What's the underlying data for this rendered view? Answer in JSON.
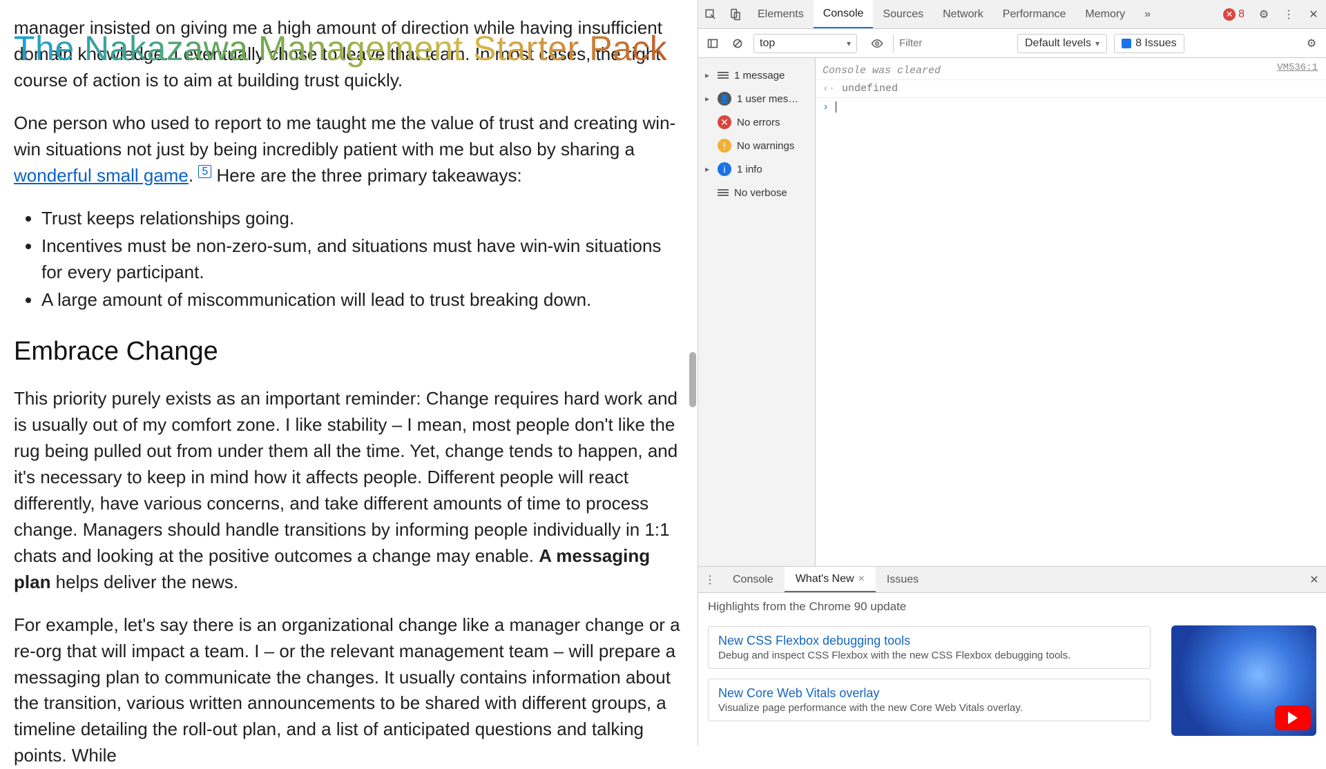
{
  "page": {
    "site_title": "The Nakazawa Management Starter Pack",
    "para1_pre": "manager insisted on giving me a high amount of direction while having insufficient domain knowledge. I eventually chose to leave that team. In most cases, the right course of action is to aim at building trust quickly.",
    "para2_a": "One person who used to report to me taught me the value of trust and creating win-win situations not just by being incredibly patient with me but also by sharing a ",
    "para2_link": "wonderful small game",
    "para2_b": ".",
    "para2_sup": "5",
    "para2_c": " Here are the three primary takeaways:",
    "bullets": [
      "Trust keeps relationships going.",
      "Incentives must be non-zero-sum, and situations must have win-win situations for every participant.",
      "A large amount of miscommunication will lead to trust breaking down."
    ],
    "h2": "Embrace Change",
    "para3_a": "This priority purely exists as an important reminder: Change requires hard work and is usually out of my comfort zone. I like stability – I mean, most people don't like the rug being pulled out from under them all the time. Yet, change tends to happen, and it's necessary to keep in mind how it affects people. Different people will react differently, have various concerns, and take different amounts of time to process change. Managers should handle transitions by informing people individually in 1:1 chats and looking at the positive outcomes a change may enable. ",
    "para3_bold": "A messaging plan",
    "para3_b": " helps deliver the news.",
    "para4": "For example, let's say there is an organizational change like a manager change or a re-org that will impact a team. I – or the relevant management team – will prepare a messaging plan to communicate the changes. It usually contains information about the transition, various written announcements to be shared with different groups, a timeline detailing the roll-out plan, and a list of anticipated questions and talking points. While"
  },
  "devtools": {
    "tabs": [
      "Elements",
      "Console",
      "Sources",
      "Network",
      "Performance",
      "Memory"
    ],
    "active_tab": "Console",
    "more_glyph": "»",
    "error_count": "8",
    "toolbar": {
      "context": "top",
      "filter_placeholder": "Filter",
      "levels_label": "Default levels",
      "issues_label": "8 Issues"
    },
    "sidebar": {
      "messages": "1 message",
      "user_msgs": "1 user mes…",
      "errors": "No errors",
      "warnings": "No warnings",
      "info": "1 info",
      "verbose": "No verbose"
    },
    "console": {
      "cleared": "Console was cleared",
      "undefined": "undefined",
      "source": "VM536:1"
    },
    "drawer": {
      "tabs": [
        "Console",
        "What's New",
        "Issues"
      ],
      "active": "What's New",
      "subtitle": "Highlights from the Chrome 90 update",
      "cards": [
        {
          "title": "New CSS Flexbox debugging tools",
          "desc": "Debug and inspect CSS Flexbox with the new CSS Flexbox debugging tools."
        },
        {
          "title": "New Core Web Vitals overlay",
          "desc": "Visualize page performance with the new Core Web Vitals overlay."
        }
      ]
    }
  }
}
